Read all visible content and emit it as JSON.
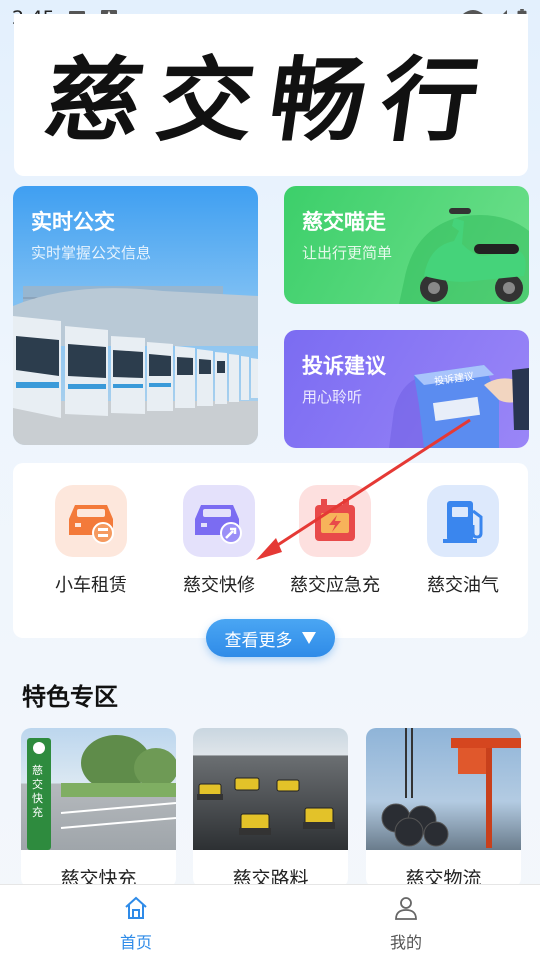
{
  "status_bar": {
    "time": "2:45"
  },
  "banner": {
    "calligraphy": "慈交畅行"
  },
  "cards": {
    "bus": {
      "title": "实时公交",
      "subtitle": "实时掌握公交信息"
    },
    "miao": {
      "title": "慈交喵走",
      "subtitle": "让出行更简单"
    },
    "complaint": {
      "title": "投诉建议",
      "subtitle": "用心聆听",
      "box_text": "投诉建议"
    }
  },
  "services": [
    {
      "label": "小车租赁",
      "icon": "car-rental-icon",
      "color": "#f37a3a"
    },
    {
      "label": "慈交快修",
      "icon": "car-repair-icon",
      "color": "#7b6cf2"
    },
    {
      "label": "慈交应急充",
      "icon": "emergency-charge-icon",
      "color": "#e84a4a"
    },
    {
      "label": "慈交油气",
      "icon": "fuel-station-icon",
      "color": "#3a86ee"
    }
  ],
  "more_button": {
    "label": "查看更多"
  },
  "section": {
    "title": "特色专区"
  },
  "features": [
    {
      "label": "慈交快充",
      "sign_text": "慈交快充"
    },
    {
      "label": "慈交路料"
    },
    {
      "label": "慈交物流"
    }
  ],
  "bottom_nav": [
    {
      "label": "首页",
      "icon": "home-icon",
      "active": true
    },
    {
      "label": "我的",
      "icon": "profile-icon",
      "active": false
    }
  ],
  "colors": {
    "accent": "#2f8be8",
    "annotation": "#e53935"
  }
}
